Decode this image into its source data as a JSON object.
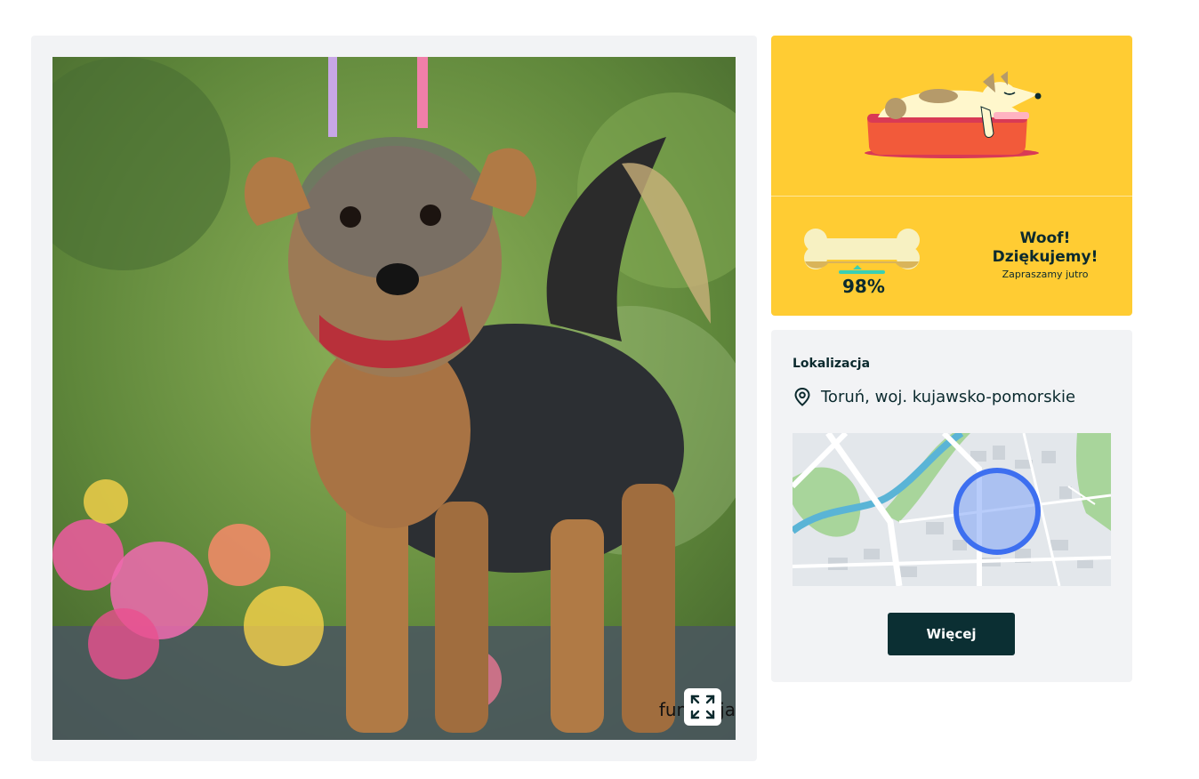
{
  "photo": {
    "alt": "Pies — zdjęcie",
    "watermark": "fundacja"
  },
  "promo": {
    "progress_percent": "98%",
    "progress_fraction": 0.98,
    "title_line1": "Woof!",
    "title_line2": "Dziękujemy!",
    "subtitle": "Zapraszamy jutro"
  },
  "location": {
    "label": "Lokalizacja",
    "value": "Toruń, woj. kujawsko-pomorskie",
    "icon": "location-pin-icon"
  },
  "actions": {
    "more_label": "Więcej"
  },
  "colors": {
    "promo_bg": "#ffcc33",
    "card_bg": "#f2f3f5",
    "button_bg": "#0b2f33",
    "map_circle": "#3d6ff0"
  }
}
